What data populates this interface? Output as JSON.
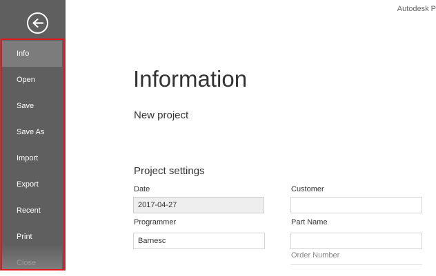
{
  "app": {
    "title": "Autodesk P"
  },
  "sidebar": {
    "items": [
      {
        "label": "Info"
      },
      {
        "label": "Open"
      },
      {
        "label": "Save"
      },
      {
        "label": "Save As"
      },
      {
        "label": "Import"
      },
      {
        "label": "Export"
      },
      {
        "label": "Recent"
      },
      {
        "label": "Print"
      },
      {
        "label": "Close"
      }
    ]
  },
  "main": {
    "title": "Information",
    "project_name": "New project",
    "settings": {
      "title": "Project settings",
      "date": {
        "label": "Date",
        "value": "2017-04-27"
      },
      "customer": {
        "label": "Customer",
        "value": ""
      },
      "programmer": {
        "label": "Programmer",
        "value": "Barnesc"
      },
      "part_name": {
        "label": "Part Name",
        "value": ""
      },
      "order_number": {
        "label": "Order Number"
      }
    }
  },
  "colors": {
    "sidebar_bg": "#5f5f5f",
    "active_item": "#7c7c7c",
    "highlight_border": "#e8141d"
  },
  "icons": {
    "back": "arrow-left-circle-icon"
  }
}
